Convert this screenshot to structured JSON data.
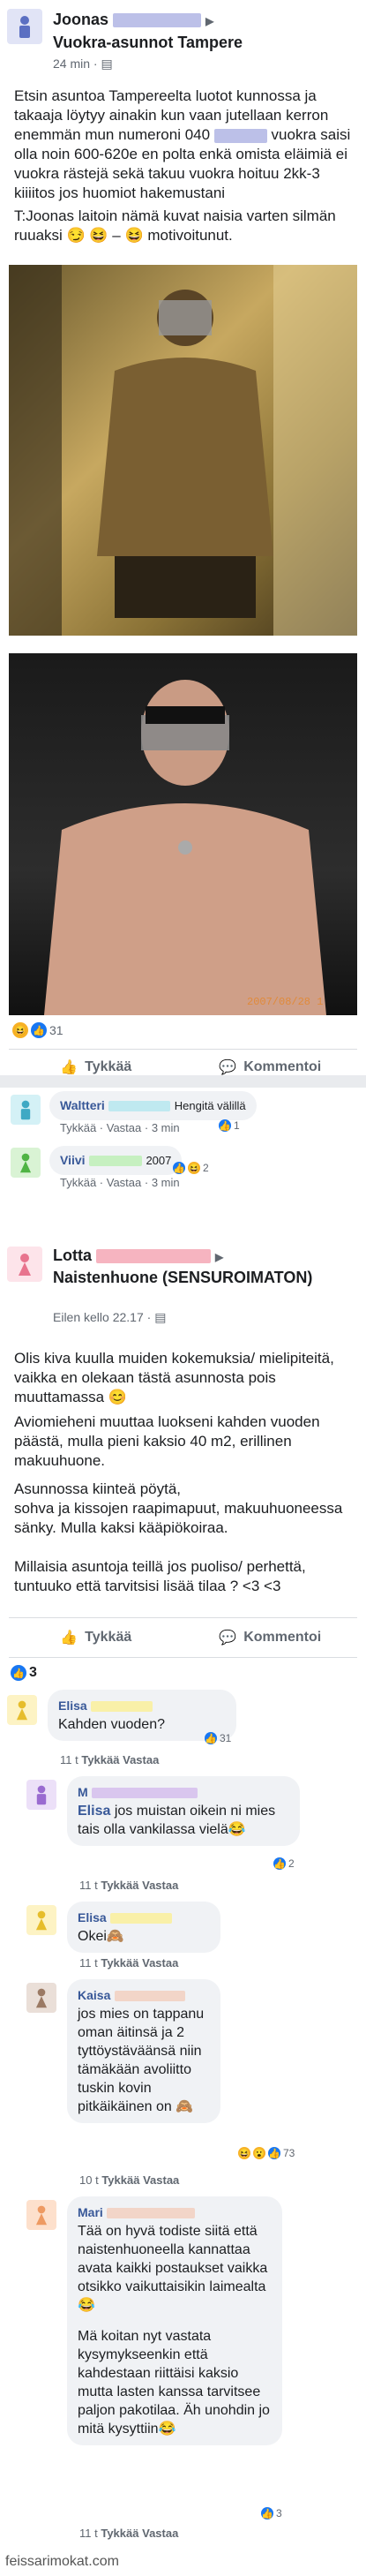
{
  "post1": {
    "author": "Joonas",
    "group": "Vuokra-asunnot Tampere",
    "time": "24 min ·",
    "body1": "Etsin asuntoa Tampereelta luotot kunnossa ja takaaja löytyy ainakin kun vaan jutellaan kerron enemmän mun numeroni 040",
    "body2": "vuokra saisi olla noin 600-620e en polta enkä omista eläimiä ei vuokra rästejä sekä takuu vuokra hoituu 2kk-3 kiiiitos jos huomiot hakemustani",
    "body3": "T:Joonas laitoin nämä kuvat naisia varten silmän ruuaksi 😏 😆 – 😆 motivoitunut.",
    "reaction_count": "31",
    "like_label": "Tykkää",
    "comment_label": "Kommentoi",
    "comments": [
      {
        "name": "Waltteri",
        "text": "Hengitä välillä",
        "like": "Tykkää",
        "reply": "Vastaa",
        "time": "3 min",
        "count": "1"
      },
      {
        "name": "Viivi",
        "text": "2007",
        "like": "Tykkää",
        "reply": "Vastaa",
        "time": "3 min",
        "count": "2"
      }
    ]
  },
  "post2": {
    "author": "Lotta",
    "author2": "Naistenhuone (SENSUROIMATON)",
    "time": "Eilen kello 22.17 ·",
    "p1": "Olis kiva kuulla muiden kokemuksia/ mielipiteitä, vaikka en olekaan tästä asunnosta pois muuttamassa 😊",
    "p2": "Aviomieheni muuttaa luokseni kahden vuoden päästä, mulla pieni kaksio 40 m2, erillinen makuuhuone.",
    "p3a": "Asunnossa kiinteä pöytä,",
    "p3b": "sohva ja kissojen raapimapuut, makuuhuoneessa sänky. Mulla kaksi kääpiökoiraa.",
    "p4": "Millaisia asuntoja teillä jos puoliso/ perhettä, tuntuuko että tarvitsisi lisää tilaa ? <3 <3",
    "like_label": "Tykkää",
    "comment_label": "Kommentoi",
    "reaction_count": "3",
    "comments": [
      {
        "name": "Elisa",
        "text": "Kahden vuoden?",
        "count": "31",
        "time": "11 t",
        "like": "Tykkää",
        "reply": "Vastaa"
      },
      {
        "name": "M",
        "tag": "Elisa",
        "text": "jos muistan oikein ni mies tais olla vankilassa vielä😂",
        "count": "2",
        "time": "11 t",
        "like": "Tykkää",
        "reply": "Vastaa"
      },
      {
        "name": "Elisa",
        "text": "Okei🙈",
        "time": "11 t",
        "like": "Tykkää",
        "reply": "Vastaa"
      },
      {
        "name": "Kaisa",
        "text": "jos mies on tappanu oman äitinsä ja 2 tyttöystäväänsä niin tämäkään avoliitto tuskin kovin pitkäikäinen on 🙈",
        "count": "73",
        "time": "10 t",
        "like": "Tykkää",
        "reply": "Vastaa"
      },
      {
        "name": "Mari",
        "text1": "Tää on hyvä todiste siitä että naistenhuoneella kannattaa avata kaikki postaukset vaikka otsikko vaikuttaisikin laimealta😂",
        "text2": "Mä koitan nyt vastata kysymykseenkin että kahdestaan riittäisi kaksio mutta lasten kanssa tarvitsee paljon pakotilaa. Äh unohdin jo mitä kysyttiin😂",
        "count": "3",
        "time": "11 t",
        "like": "Tykkää",
        "reply": "Vastaa"
      }
    ]
  },
  "footer": "feissarimokat.com",
  "colors": {
    "avatar_blue": "#7b8fd0",
    "avatar_pink": "#f199ad",
    "link": "#385898"
  }
}
